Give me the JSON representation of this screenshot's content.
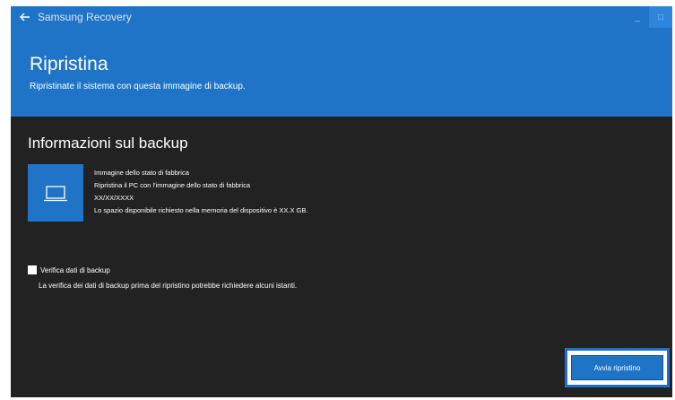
{
  "app": {
    "title": "Samsung Recovery",
    "back_icon": "arrow-left-icon",
    "controls": [
      {
        "name": "minimize",
        "glyph": "_"
      },
      {
        "name": "restore",
        "glyph": "□"
      }
    ]
  },
  "header": {
    "title": "Ripristina",
    "subtitle": "Ripristinate il sistema con questa immagine di backup."
  },
  "backup_info": {
    "title": "Informazioni sul backup",
    "icon": "laptop-icon",
    "name": "Immagine dello stato di fabbrica",
    "description": "Ripristina il PC con l'immagine dello stato di fabbrica",
    "date": "XX/XX/XXXX",
    "space_required": "Lo spazio disponibile richiesto nella memoria del dispositivo è XX.X GB."
  },
  "verify": {
    "label": "Verifica dati di backup",
    "checked": false,
    "description": "La verifica dei dati di backup prima del ripristino potrebbe richiedere alcuni istanti."
  },
  "actions": {
    "start_restore_label": "Avvia ripristino"
  },
  "colors": {
    "accent": "#1f74c8",
    "background": "#222222",
    "highlight": "#1a6fd0"
  }
}
